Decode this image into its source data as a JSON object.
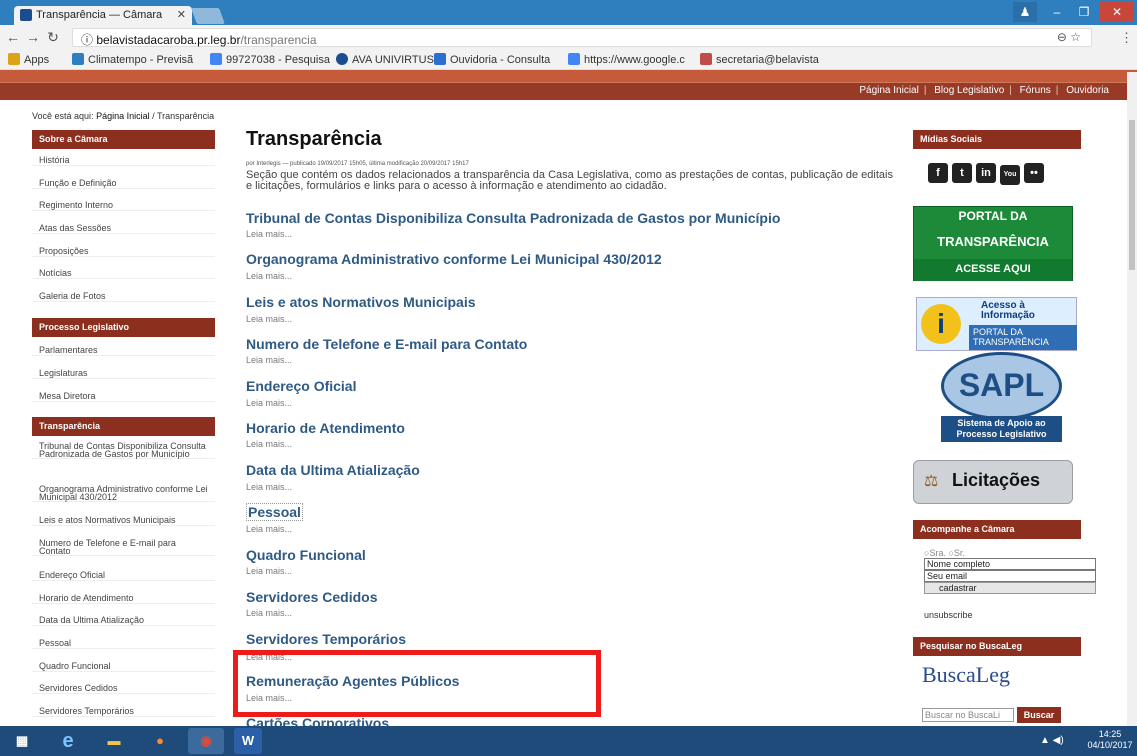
{
  "browser": {
    "tab_title": "Transparência — Câmara",
    "url_host": "belavistadacaroba.pr.leg.br",
    "url_path": "/transparencia",
    "bookmarks": [
      "Apps",
      "Climatempo - Previsã",
      "99727038 - Pesquisa",
      "AVA UNIVIRTUS",
      "Ouvidoria - Consulta",
      "https://www.google.c",
      "secretaria@belavista"
    ]
  },
  "site_nav": {
    "links": [
      "Página Inicial",
      "Blog Legislativo",
      "Fóruns",
      "Ouvidoria"
    ]
  },
  "breadcrumb": {
    "prefix": "Você está aqui:",
    "home": "Página Inicial",
    "sep": "/",
    "current": "Transparência"
  },
  "left_nav": {
    "sections": [
      {
        "title": "Sobre a Câmara",
        "items": [
          "História",
          "Função e Definição",
          "Regimento Interno",
          "Atas das Sessões",
          "Proposições",
          "Notícias",
          "Galeria de Fotos"
        ]
      },
      {
        "title": "Processo Legislativo",
        "items": [
          "Parlamentares",
          "Legislaturas",
          "Mesa Diretora"
        ]
      },
      {
        "title": "Transparência",
        "items": [
          "Tribunal de Contas Disponibiliza Consulta Padronizada de Gastos por Município",
          "Organograma Administrativo conforme Lei Municipal 430/2012",
          "Leis e atos Normativos Municipais",
          "Numero de Telefone e E-mail para Contato",
          "Endereço Oficial",
          "Horario de Atendimento",
          "Data da Ultima Atialização",
          "Pessoal",
          "Quadro Funcional",
          "Servidores Cedidos",
          "Servidores Temporários"
        ]
      }
    ]
  },
  "main": {
    "title": "Transparência",
    "byline": "por Interlegis — publicado 19/09/2017 15h05, última modificação 20/09/2017 15h17",
    "description": "Seção que contém os dados relacionados a transparência da Casa Legislativa, como as prestações de contas, publicação de editais e licitações, formulários e links para o acesso à informação e atendimento ao cidadão.",
    "read_more": "Leia mais...",
    "entries": [
      "Tribunal de Contas Disponibiliza Consulta Padronizada de Gastos por Município",
      "Organograma Administrativo conforme Lei Municipal 430/2012",
      "Leis e atos Normativos Municipais",
      "Numero de Telefone e E-mail para Contato",
      "Endereço Oficial",
      "Horario de Atendimento",
      "Data da Ultima Atialização",
      "Pessoal",
      "Quadro Funcional",
      "Servidores Cedidos",
      "Servidores Temporários",
      "Remuneração Agentes Públicos",
      "Cartões Corporativos"
    ]
  },
  "right": {
    "social_title": "Mídias Sociais",
    "social_icons": [
      "f",
      "t",
      "in",
      "You",
      "••"
    ],
    "transparency_banner": [
      "PORTAL DA",
      "TRANSPARÊNCIA",
      "ACESSE AQUI"
    ],
    "acesso_banner": [
      "Acesso à",
      "Informação",
      "PORTAL DA",
      "TRANSPARÊNCIA"
    ],
    "sapl_banner": [
      "SAPL",
      "Sistema de Apoio ao",
      "Processo Legislativo"
    ],
    "licitacoes": "Licitações",
    "follow_title": "Acompanhe a Câmara",
    "radio_sra": "Sra.",
    "radio_sr": "Sr.",
    "name_value": "Nome completo",
    "email_value": "Seu email",
    "submit_label": "cadastrar",
    "unsubscribe": "unsubscribe",
    "search_title": "Pesquisar no BuscaLeg",
    "buscaleg_logo": "BuscaLeg",
    "search_placeholder": "Buscar no BuscaLi",
    "search_button": "Buscar"
  },
  "taskbar": {
    "time": "14:25",
    "date": "04/10/2017"
  }
}
